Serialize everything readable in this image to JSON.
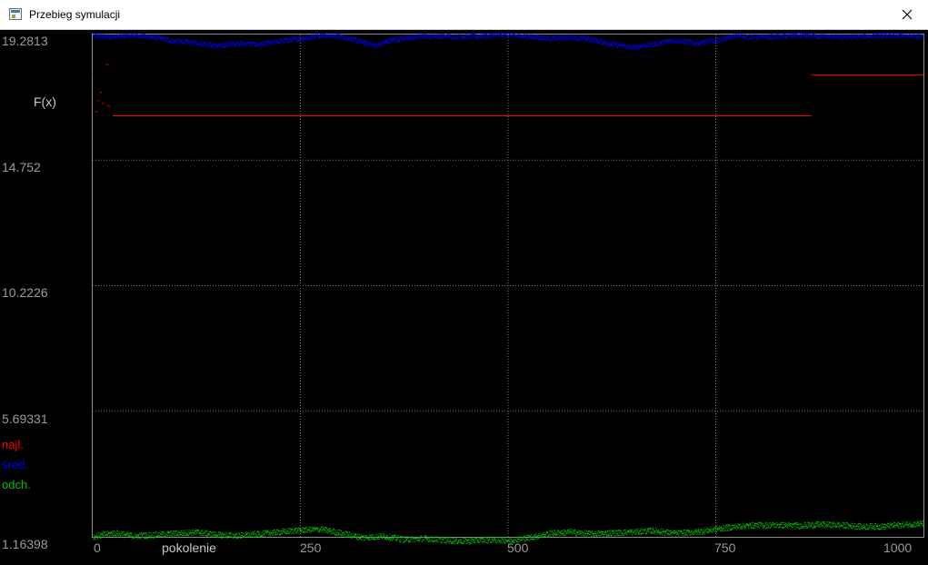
{
  "window": {
    "title": "Przebieg symulacji",
    "icon": "app-window-icon",
    "close_icon": "close-icon"
  },
  "chart_data": {
    "type": "scatter",
    "ylabel": "F(x)",
    "xlabel": "pokolenie",
    "y_ticks": [
      "19.2813",
      "14.752",
      "10.2226",
      "5.69331",
      "1.16398"
    ],
    "x_ticks": [
      "0",
      "250",
      "500",
      "750",
      "1000"
    ],
    "xlim": [
      0,
      1000
    ],
    "ylim": [
      1.16398,
      19.2813
    ],
    "grid": true,
    "legend_placement": "left",
    "colors": {
      "najl": "#ff0000",
      "sred": "#0000ff",
      "odch": "#00c000",
      "grid": "#7a7a7a",
      "frame": "#8a8a8a"
    },
    "series": [
      {
        "name": "najl.",
        "segments": [
          {
            "x": [
              0,
              1
            ],
            "y": 17.7
          },
          {
            "x": [
              16,
              19
            ],
            "y": 18.2
          },
          {
            "x": [
              9,
              11
            ],
            "y": 17.2
          },
          {
            "x": [
              6,
              8
            ],
            "y": 16.9
          },
          {
            "x": [
              11,
              13
            ],
            "y": 16.8
          },
          {
            "x": [
              18,
              21
            ],
            "y": 16.7
          },
          {
            "x": [
              3,
              6
            ],
            "y": 16.5
          },
          {
            "x": [
              24,
              865
            ],
            "y": 16.35
          },
          {
            "x": [
              865,
              1000
            ],
            "y": 17.82
          }
        ]
      },
      {
        "name": "śred.",
        "values": [
          [
            0,
            19.25
          ],
          [
            25,
            19.2
          ],
          [
            50,
            19.28
          ],
          [
            75,
            19.18
          ],
          [
            100,
            19.05
          ],
          [
            125,
            19.0
          ],
          [
            150,
            18.88
          ],
          [
            175,
            18.98
          ],
          [
            200,
            18.93
          ],
          [
            225,
            19.05
          ],
          [
            250,
            19.15
          ],
          [
            275,
            19.28
          ],
          [
            300,
            19.22
          ],
          [
            325,
            19.02
          ],
          [
            340,
            18.9
          ],
          [
            360,
            19.1
          ],
          [
            400,
            19.25
          ],
          [
            450,
            19.22
          ],
          [
            500,
            19.28
          ],
          [
            525,
            19.22
          ],
          [
            550,
            19.15
          ],
          [
            575,
            19.2
          ],
          [
            600,
            19.12
          ],
          [
            625,
            18.95
          ],
          [
            650,
            18.82
          ],
          [
            675,
            18.95
          ],
          [
            700,
            19.1
          ],
          [
            725,
            18.98
          ],
          [
            750,
            19.08
          ],
          [
            775,
            19.25
          ],
          [
            800,
            19.2
          ],
          [
            850,
            19.26
          ],
          [
            900,
            19.2
          ],
          [
            950,
            19.26
          ],
          [
            1000,
            19.24
          ]
        ]
      },
      {
        "name": "odch.",
        "values": [
          [
            0,
            1.18
          ],
          [
            25,
            1.32
          ],
          [
            50,
            1.2
          ],
          [
            75,
            1.25
          ],
          [
            100,
            1.3
          ],
          [
            125,
            1.35
          ],
          [
            150,
            1.25
          ],
          [
            175,
            1.22
          ],
          [
            200,
            1.28
          ],
          [
            225,
            1.35
          ],
          [
            250,
            1.42
          ],
          [
            275,
            1.45
          ],
          [
            300,
            1.3
          ],
          [
            325,
            1.15
          ],
          [
            350,
            1.2
          ],
          [
            375,
            1.08
          ],
          [
            400,
            1.12
          ],
          [
            425,
            1.05
          ],
          [
            450,
            1.02
          ],
          [
            475,
            1.08
          ],
          [
            500,
            1.05
          ],
          [
            525,
            1.15
          ],
          [
            550,
            1.3
          ],
          [
            575,
            1.35
          ],
          [
            600,
            1.28
          ],
          [
            625,
            1.32
          ],
          [
            650,
            1.35
          ],
          [
            675,
            1.4
          ],
          [
            700,
            1.3
          ],
          [
            725,
            1.35
          ],
          [
            750,
            1.45
          ],
          [
            775,
            1.55
          ],
          [
            800,
            1.6
          ],
          [
            825,
            1.6
          ],
          [
            850,
            1.58
          ],
          [
            875,
            1.62
          ],
          [
            900,
            1.6
          ],
          [
            925,
            1.55
          ],
          [
            950,
            1.55
          ],
          [
            975,
            1.62
          ],
          [
            1000,
            1.65
          ]
        ]
      }
    ]
  }
}
